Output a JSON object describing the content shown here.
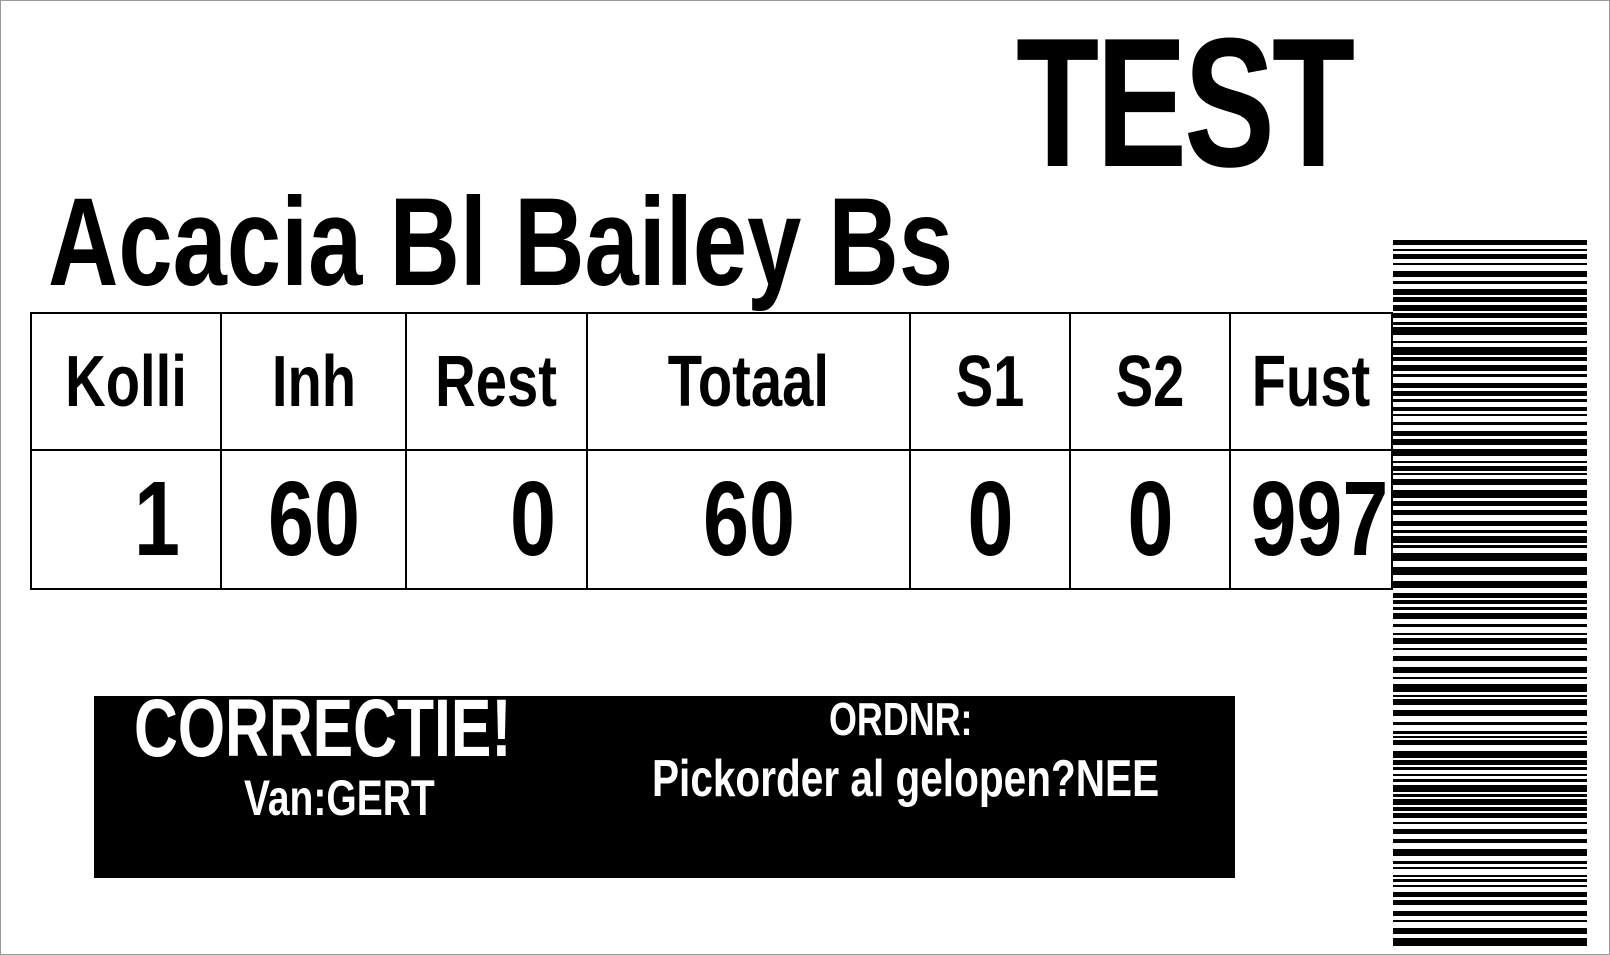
{
  "label": {
    "stamp": "TEST",
    "product_name": "Acacia Bl Bailey Bs"
  },
  "table": {
    "headers": [
      "Kolli",
      "Inh",
      "Rest",
      "Totaal",
      "S1",
      "S2",
      "Fust"
    ],
    "values": [
      "1",
      "60",
      "0",
      "60",
      "0",
      "0",
      "997"
    ]
  },
  "correction": {
    "title": "CORRECTIE!",
    "from": "Van:GERT",
    "order_label": "ORDNR:",
    "pick_question": "Pickorder al gelopen?NEE"
  },
  "barcode": {
    "orientation": "vertical",
    "color": "#000000"
  }
}
